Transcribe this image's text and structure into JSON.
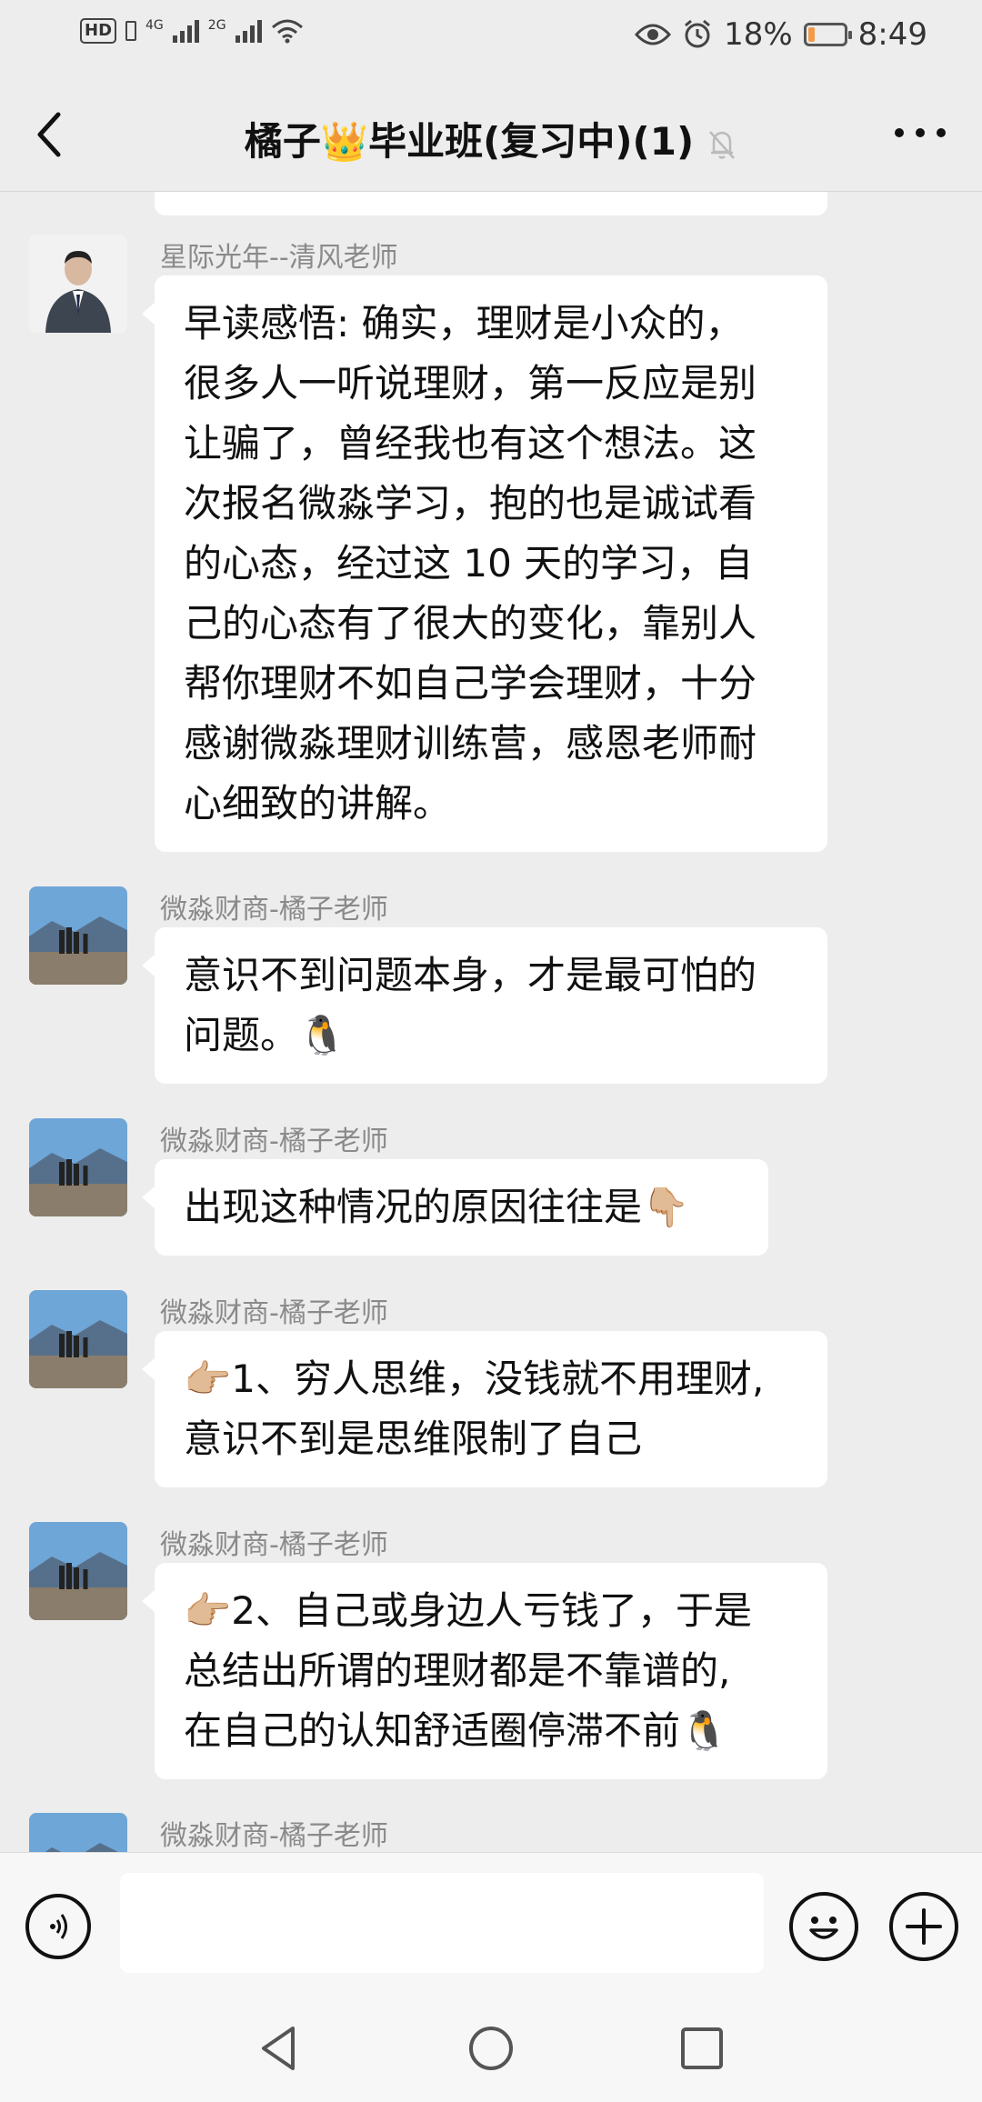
{
  "status_bar": {
    "hd": "HD",
    "sim1_network": "4G",
    "sim2_network": "2G",
    "battery_percent": "18%",
    "battery_level": 0.18,
    "time": "8:49",
    "icons": [
      "eye-icon",
      "alarm-icon",
      "wifi-icon"
    ]
  },
  "header": {
    "title_part1": "橘子",
    "title_emoji": "👑",
    "title_part2": "毕业班(复习中)(1)",
    "muted": true
  },
  "messages": [
    {
      "sender": "星际光年--清风老师",
      "avatar": "man-in-suit-avatar",
      "lines": [
        "早读感悟: 确实，理财是小众的，",
        "很多人一听说理财，第一反应是别",
        "让骗了，曾经我也有这个想法。这",
        "次报名微淼学习，抱的也是诚试看",
        "的心态，经过这 10 天的学习，自",
        "己的心态有了很大的变化，靠别人",
        "帮你理财不如自己学会理财，十分",
        "感谢微淼理财训练营，感恩老师耐",
        "心细致的讲解。"
      ]
    },
    {
      "sender": "微淼财商-橘子老师",
      "avatar": "landscape-avatar",
      "lines": [
        "意识不到问题本身，才是最可怕的",
        "问题。🐧"
      ]
    },
    {
      "sender": "微淼财商-橘子老师",
      "avatar": "landscape-avatar",
      "lines": [
        "出现这种情况的原因往往是👇🏼"
      ]
    },
    {
      "sender": "微淼财商-橘子老师",
      "avatar": "landscape-avatar",
      "lines": [
        "👉🏼1、穷人思维，没钱就不用理财,",
        "意识不到是思维限制了自己"
      ]
    },
    {
      "sender": "微淼财商-橘子老师",
      "avatar": "landscape-avatar",
      "lines": [
        "👉🏼2、自己或身边人亏钱了，于是",
        "总结出所谓的理财都是不靠谱的,",
        "在自己的认知舒适圈停滞不前🐧"
      ]
    },
    {
      "sender": "微淼财商-橘子老师",
      "avatar": "landscape-avatar",
      "lines": []
    }
  ],
  "input_bar": {
    "value": "",
    "placeholder": ""
  },
  "colors": {
    "background": "#ededed",
    "bubble": "#ffffff",
    "sender_name": "#8a8a8a",
    "battery_fill": "#f29a4a"
  }
}
